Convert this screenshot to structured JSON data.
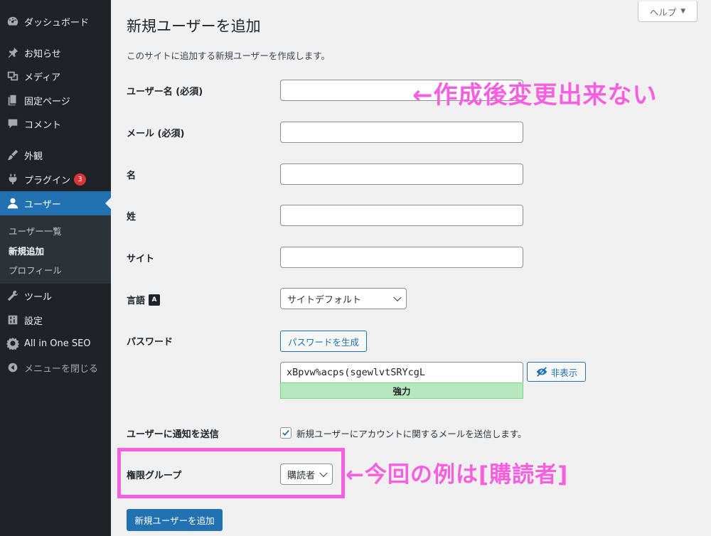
{
  "sidebar": {
    "items": [
      {
        "label": "ダッシュボード",
        "icon": "dashboard-icon"
      },
      {
        "label": "お知らせ",
        "icon": "pin-icon"
      },
      {
        "label": "メディア",
        "icon": "media-icon"
      },
      {
        "label": "固定ページ",
        "icon": "page-icon"
      },
      {
        "label": "コメント",
        "icon": "comment-icon"
      },
      {
        "label": "外観",
        "icon": "brush-icon"
      },
      {
        "label": "プラグイン",
        "icon": "plugin-icon",
        "badge": "3"
      },
      {
        "label": "ユーザー",
        "icon": "user-icon"
      },
      {
        "label": "ツール",
        "icon": "wrench-icon"
      },
      {
        "label": "設定",
        "icon": "settings-icon"
      },
      {
        "label": "All in One SEO",
        "icon": "aioseo-icon"
      },
      {
        "label": "メニューを閉じる",
        "icon": "collapse-icon"
      }
    ],
    "submenu": [
      "ユーザー一覧",
      "新規追加",
      "プロフィール"
    ]
  },
  "header": {
    "help_label": "ヘルプ",
    "title": "新規ユーザーを追加",
    "description": "このサイトに追加する新規ユーザーを作成します。"
  },
  "form": {
    "username_label": "ユーザー名 (必須)",
    "username_value": "",
    "email_label": "メール (必須)",
    "email_value": "",
    "first_name_label": "名",
    "first_name_value": "",
    "last_name_label": "姓",
    "last_name_value": "",
    "site_label": "サイト",
    "site_value": "",
    "language_label": "言語",
    "language_value": "サイトデフォルト",
    "password_label": "パスワード",
    "generate_password_label": "パスワードを生成",
    "password_value": "xBpvw%acps(sgewlvtSRYcgL",
    "strength_label": "強力",
    "hide_label": "非表示",
    "notify_label": "ユーザーに通知を送信",
    "notify_text": "新規ユーザーにアカウントに関するメールを送信します。",
    "notify_checked": true,
    "role_label": "権限グループ",
    "role_value": "購読者",
    "submit_label": "新規ユーザーを追加"
  },
  "annotations": {
    "username_note": "←作成後変更出来ない",
    "role_note": "←今回の例は[購読者]"
  },
  "colors": {
    "sidebar_bg": "#1d2327",
    "accent": "#2271b1",
    "annotation": "#f55fe0",
    "strength_bg": "#b8e6bf"
  }
}
